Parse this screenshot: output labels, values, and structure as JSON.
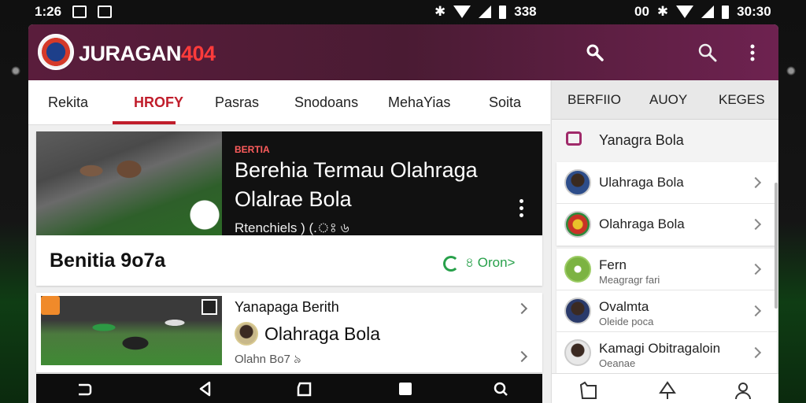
{
  "status_bar": {
    "left_time": "1:26",
    "center_time": "338",
    "right_prefix": "00",
    "right_time": "30:30"
  },
  "header": {
    "title_main": "JURAGAN",
    "title_accent": "404"
  },
  "tabs": [
    {
      "label": "Rekita"
    },
    {
      "label": "HROFY",
      "active": true
    },
    {
      "label": "Pasras"
    },
    {
      "label": "Snodoans"
    },
    {
      "label": "MehaYias"
    },
    {
      "label": "Soita"
    }
  ],
  "hero": {
    "kicker": "BERTIA",
    "title_line1": "Berehia Termau Olahraga",
    "title_line2": "Olalrae Bola",
    "meta": "Rtenchiels )  (.ঃ ৬",
    "bottom_title": "Benitia 9o7a",
    "cta_label": "৪ Oron>"
  },
  "card2": {
    "kicker": "Yanapaga Berith",
    "title": "Olahraga Bola",
    "meta": "Olahn Bo7 ৯"
  },
  "side": {
    "tabs": [
      "BERFIIO",
      "AUOY",
      "KEGES"
    ],
    "header": "Yanagra Bola",
    "group1": [
      {
        "title": "Ulahraga Bola",
        "sub": ""
      },
      {
        "title": "Olahraga Bola",
        "sub": ""
      }
    ],
    "group2": [
      {
        "title": "Fern",
        "sub": "Meagragr fari"
      },
      {
        "title": "Ovalmta",
        "sub": "Oleide poca"
      },
      {
        "title": "Kamagi Obitragaloin",
        "sub": "Oeanae"
      }
    ]
  },
  "colors": {
    "header_bg": "#5a1d3c",
    "accent_red": "#c01d2b",
    "cta_green": "#27a04a"
  }
}
